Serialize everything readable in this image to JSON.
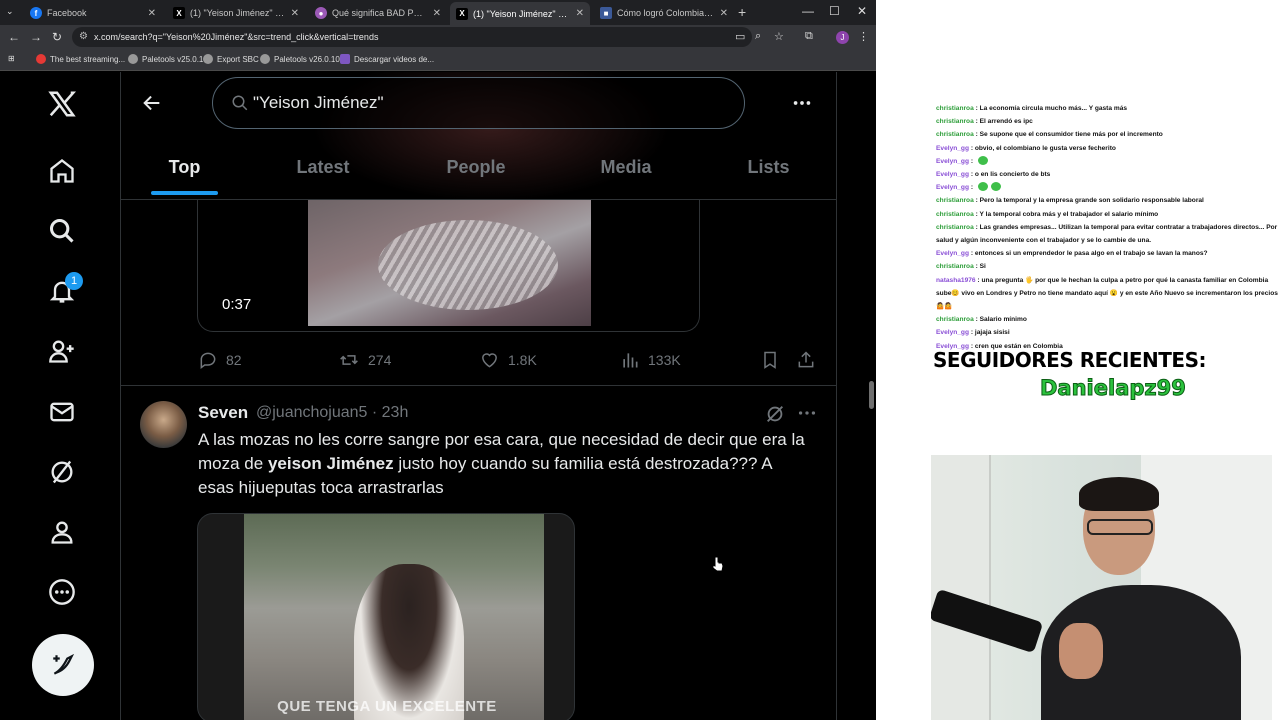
{
  "browser": {
    "tabs": [
      {
        "label": "Facebook",
        "fav": "f",
        "color": "#1877f2"
      },
      {
        "label": "(1) \"Yeison Jiménez\" - Search / X",
        "fav": "X",
        "color": "#000000"
      },
      {
        "label": "Qué significa BAD PRB, señal qu",
        "fav": "●",
        "color": "#9b59b6"
      },
      {
        "label": "(1) \"Yeison Jiménez\" - Search / X",
        "fav": "X",
        "color": "#000000"
      },
      {
        "label": "Cómo logró Colombia converti",
        "fav": "■",
        "color": "#3b5998"
      }
    ],
    "url": "x.com/search?q=\"Yeison%20Jiménez\"&src=trend_click&vertical=trends",
    "profile_initial": "J",
    "bookmarks": [
      {
        "label": "The best streaming...",
        "color": "#e53935"
      },
      {
        "label": "Paletools v25.0.1",
        "color": "#888888"
      },
      {
        "label": "Export SBC",
        "color": "#888888"
      },
      {
        "label": "Paletools v26.0.10",
        "color": "#888888"
      },
      {
        "label": "Descargar videos de...",
        "color": "#7e57c2"
      }
    ]
  },
  "x": {
    "search_query": "\"Yeison Jiménez\"",
    "tabs": [
      "Top",
      "Latest",
      "People",
      "Media",
      "Lists"
    ],
    "notification_count": "1",
    "tweet1": {
      "duration": "0:37",
      "replies": "82",
      "reposts": "274",
      "likes": "1.8K",
      "views": "133K"
    },
    "tweet2": {
      "name": "Seven",
      "handle": "@juanchojuan5 · 23h",
      "text_before": "A las mozas no les corre sangre por esa cara, que necesidad de decir que era la moza de ",
      "text_bold": "yeison Jiménez",
      "text_after": " justo hoy cuando su familia está destrozada??? A esas hijueputas toca arrastrarlas",
      "video_caption": "QUE TENGA UN EXCELENTE"
    }
  },
  "stream": {
    "chat": [
      {
        "user": "christianroa",
        "msg": "La economía circula mucho más... Y gasta más",
        "color": "#2e9e3a"
      },
      {
        "user": "christianroa",
        "msg": "El arrendó es ipc",
        "color": "#2e9e3a"
      },
      {
        "user": "christianroa",
        "msg": "Se supone que el consumidor tiene más por el incremento",
        "color": "#2e9e3a"
      },
      {
        "user": "Evelyn_gg",
        "msg": "obvio, el colombiano le gusta verse fecherito",
        "color": "#8a4fd6"
      },
      {
        "user": "Evelyn_gg",
        "msg": "",
        "color": "#8a4fd6",
        "emotes": 1
      },
      {
        "user": "Evelyn_gg",
        "msg": "o en lis concierto de bts",
        "color": "#8a4fd6"
      },
      {
        "user": "Evelyn_gg",
        "msg": "",
        "color": "#8a4fd6",
        "emotes": 2
      },
      {
        "user": "christianroa",
        "msg": "Pero la temporal y la empresa grande son solidario responsable laboral",
        "color": "#2e9e3a"
      },
      {
        "user": "christianroa",
        "msg": "Y la temporal cobra más y el trabajador el salario mínimo",
        "color": "#2e9e3a"
      },
      {
        "user": "christianroa",
        "msg": "Las grandes empresas... Utilizan la temporal para evitar contratar a trabajadores directos... Por salud y algún inconveniente con el trabajador y se lo cambie de una.",
        "color": "#2e9e3a"
      },
      {
        "user": "Evelyn_gg",
        "msg": "entonces si un emprendedor le pasa algo en el trabajo se lavan la manos?",
        "color": "#8a4fd6"
      },
      {
        "user": "christianroa",
        "msg": "Si",
        "color": "#2e9e3a"
      },
      {
        "user": "natasha1976",
        "msg": "una pregunta 🖐 por que le hechan la culpa a petro por qué la canasta familiar en Colombia sube😊 vivo en Londres y Petro no tiene mandato aquí 😮 y en este Año Nuevo se incrementaron los precios 🤷🤷",
        "color": "#8a4fd6"
      },
      {
        "user": "christianroa",
        "msg": "Salario mínimo",
        "color": "#2e9e3a"
      },
      {
        "user": "Evelyn_gg",
        "msg": "jajaja sisisi",
        "color": "#8a4fd6"
      },
      {
        "user": "Evelyn_gg",
        "msg": "cren que están en Colombia",
        "color": "#8a4fd6"
      }
    ],
    "followers_title": "SEGUIDORES RECIENTES:",
    "follower_name": "Danielapz99"
  }
}
